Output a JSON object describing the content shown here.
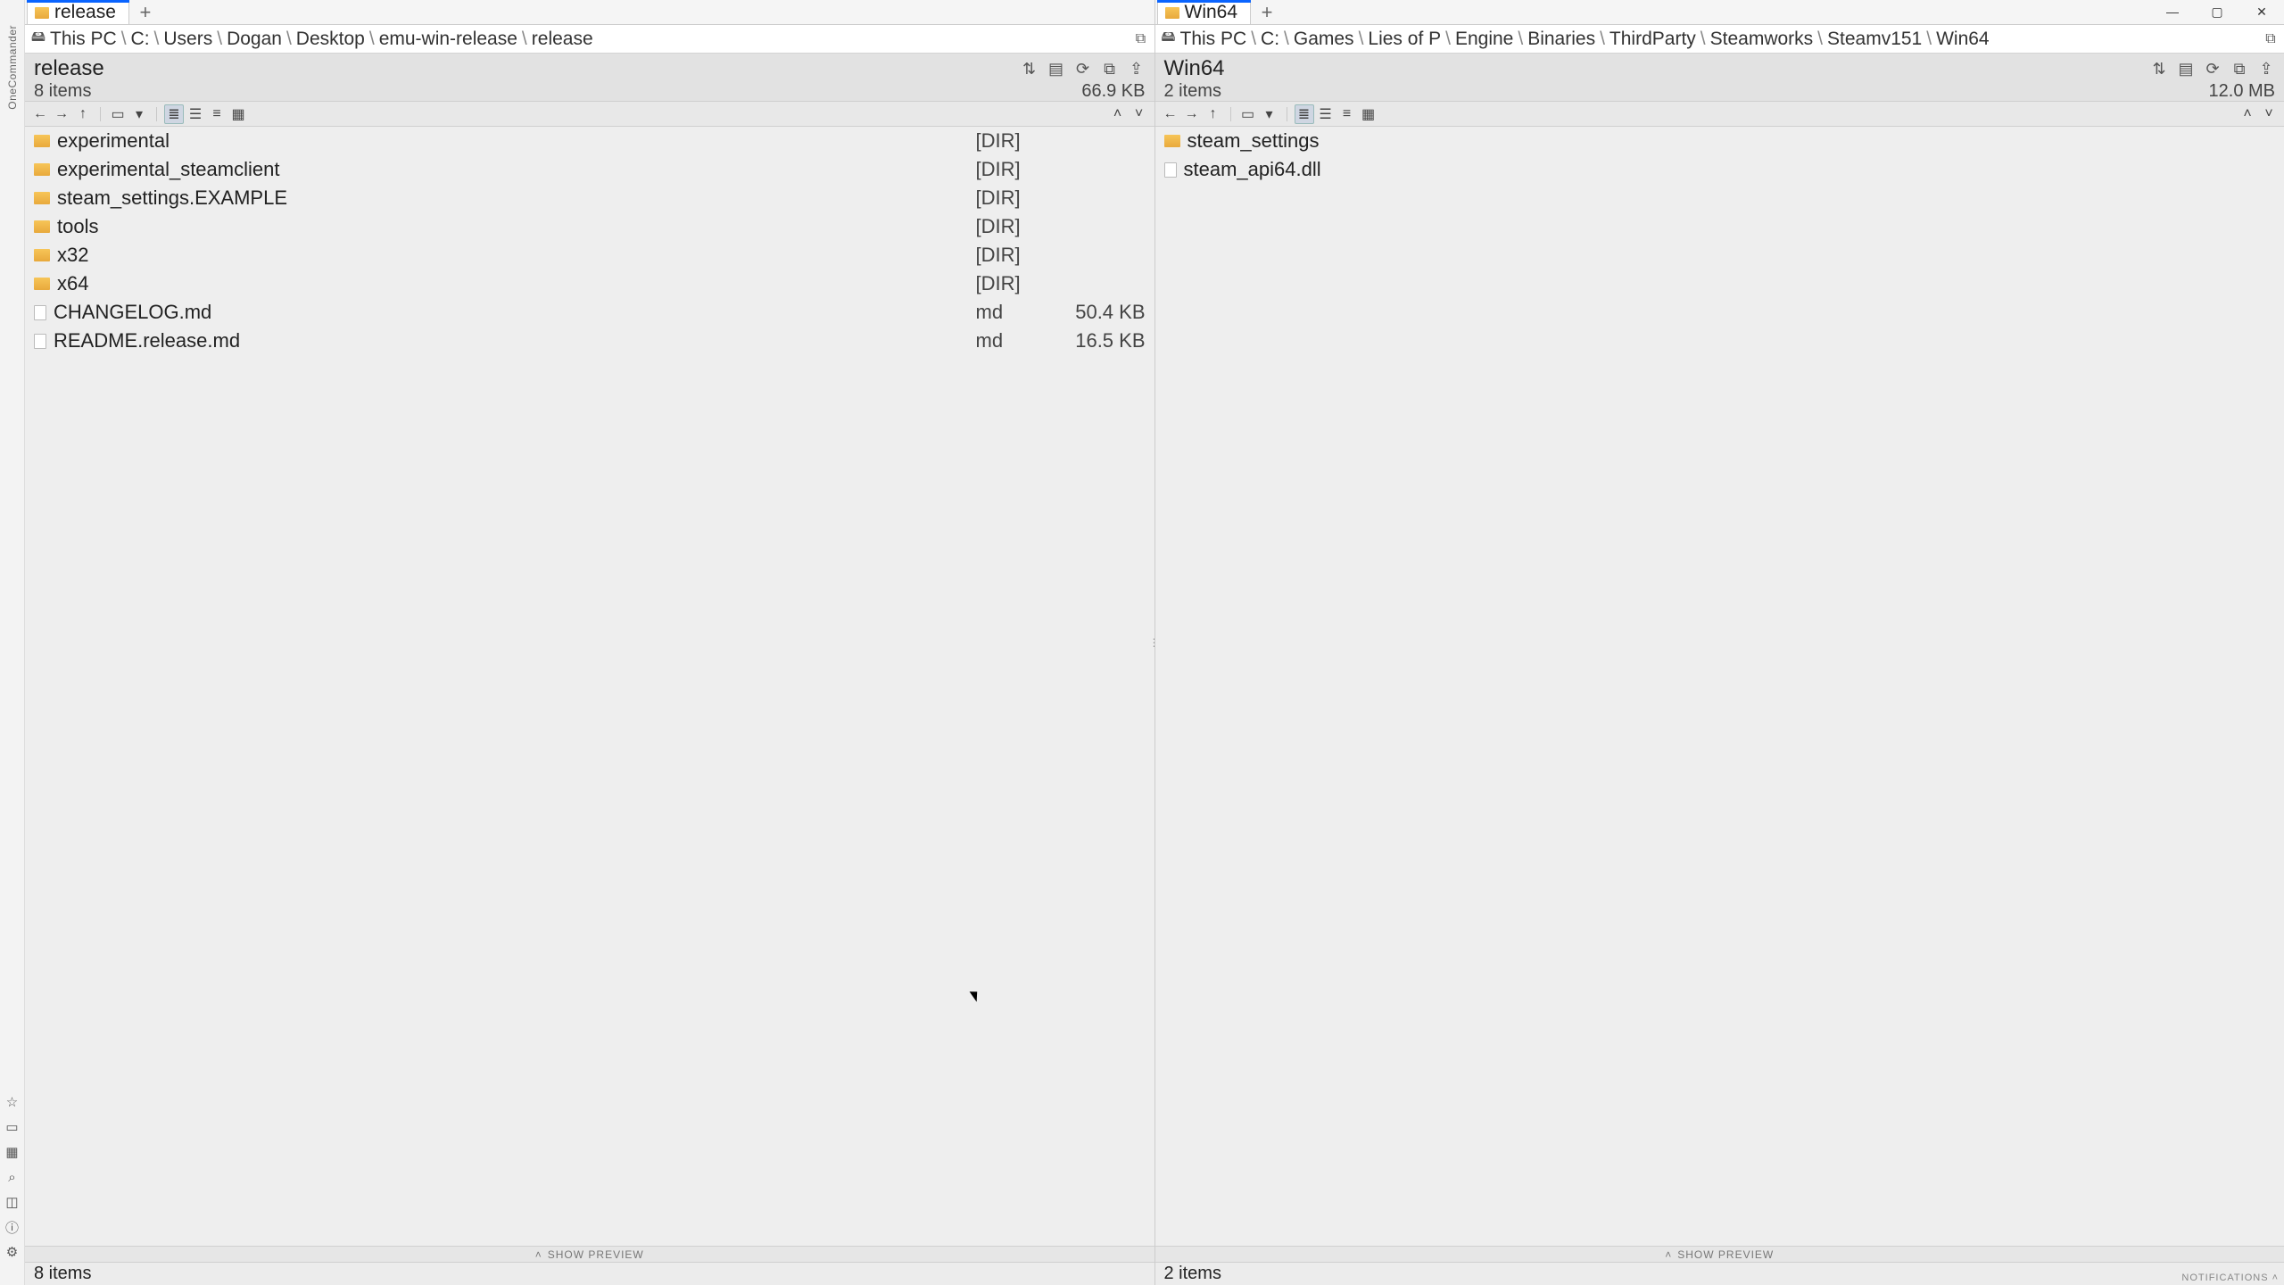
{
  "app": {
    "name": "OneCommander",
    "vertical_rail_label": "OneCommander",
    "window_buttons": {
      "min": "—",
      "max": "▢",
      "close": "✕"
    },
    "notifications_label": "NOTIFICATIONS"
  },
  "rail_icons": [
    {
      "name": "star-icon",
      "glyph": "☆"
    },
    {
      "name": "window-icon",
      "glyph": "▭"
    },
    {
      "name": "grid-icon",
      "glyph": "▦"
    },
    {
      "name": "search-icon",
      "glyph": "⌕"
    },
    {
      "name": "panel-icon",
      "glyph": "◫"
    },
    {
      "name": "info-icon",
      "glyph": "ⓘ"
    },
    {
      "name": "gear-icon",
      "glyph": "⚙"
    }
  ],
  "panes": [
    {
      "tab": {
        "label": "release"
      },
      "path": {
        "root": "This PC",
        "crumbs": [
          "C:",
          "Users",
          "Dogan",
          "Desktop",
          "emu-win-release",
          "release"
        ]
      },
      "info": {
        "title": "release",
        "count": "8 items",
        "size": "66.9 KB"
      },
      "sort_row": {
        "type_caret": "˄",
        "size_caret": "˅"
      },
      "files": [
        {
          "name": "experimental",
          "kind": "folder",
          "type": "[DIR]",
          "size": ""
        },
        {
          "name": "experimental_steamclient",
          "kind": "folder",
          "type": "[DIR]",
          "size": ""
        },
        {
          "name": "steam_settings.EXAMPLE",
          "kind": "folder",
          "type": "[DIR]",
          "size": ""
        },
        {
          "name": "tools",
          "kind": "folder",
          "type": "[DIR]",
          "size": ""
        },
        {
          "name": "x32",
          "kind": "folder",
          "type": "[DIR]",
          "size": ""
        },
        {
          "name": "x64",
          "kind": "folder",
          "type": "[DIR]",
          "size": ""
        },
        {
          "name": "CHANGELOG.md",
          "kind": "file",
          "type": "md",
          "size": "50.4 KB"
        },
        {
          "name": "README.release.md",
          "kind": "file",
          "type": "md",
          "size": "16.5 KB"
        }
      ],
      "status": "8 items",
      "preview_label": "SHOW PREVIEW"
    },
    {
      "tab": {
        "label": "Win64"
      },
      "path": {
        "root": "This PC",
        "crumbs": [
          "C:",
          "Games",
          "Lies of P",
          "Engine",
          "Binaries",
          "ThirdParty",
          "Steamworks",
          "Steamv151",
          "Win64"
        ]
      },
      "info": {
        "title": "Win64",
        "count": "2 items",
        "size": "12.0 MB"
      },
      "sort_row": {
        "type_caret": "˄",
        "size_caret": "˅"
      },
      "files": [
        {
          "name": "steam_settings",
          "kind": "folder",
          "type": "",
          "size": ""
        },
        {
          "name": "steam_api64.dll",
          "kind": "file",
          "type": "",
          "size": ""
        }
      ],
      "status": "2 items",
      "preview_label": "SHOW PREVIEW"
    }
  ],
  "toolbar_icons": {
    "back": "←",
    "forward": "→",
    "up": "↑",
    "history": "▾",
    "new_folder": "▭",
    "dropdown": "▾",
    "view_list": "≣",
    "view_details": "☰",
    "view_compact": "≡",
    "view_tiles": "▦"
  },
  "info_tool_icons": {
    "sort": "⇅",
    "filter": "▤",
    "refresh": "⟳",
    "copy": "⧉",
    "pin": "⇪"
  },
  "path_sep": "\\"
}
